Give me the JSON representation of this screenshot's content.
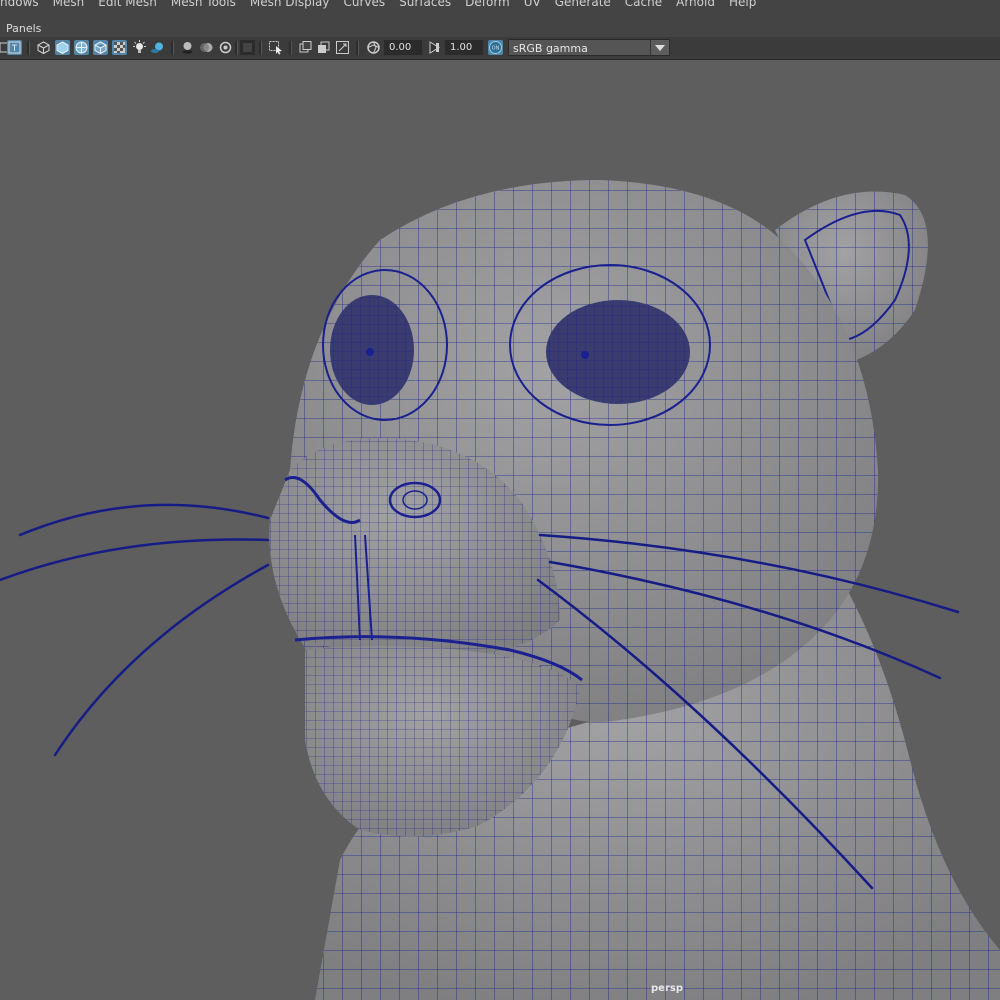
{
  "menubar": {
    "items": [
      "ndows",
      "Mesh",
      "Edit Mesh",
      "Mesh Tools",
      "Mesh Display",
      "Curves",
      "Surfaces",
      "Deform",
      "UV",
      "Generate",
      "Cache",
      "Arnold",
      "Help"
    ]
  },
  "panel": {
    "menu_label": "Panels"
  },
  "toolbar": {
    "exposure_value": "0.00",
    "gamma_value": "1.00",
    "color_management_label": "sRGB gamma",
    "icons": [
      "frame-icon",
      "film-gate-icon",
      "wireframe-icon",
      "smooth-shade-icon",
      "shade-wireframe-icon",
      "textured-icon",
      "xray-icon",
      "lights-icon",
      "shadows-icon",
      "ambient-occlusion-icon",
      "motion-blur-icon",
      "antialias-icon",
      "isolate-select-icon",
      "select-camera-icon",
      "two-panel-icon",
      "lock-camera-icon",
      "resolution-gate-icon",
      "exposure-icon",
      "gamma-icon",
      "color-management-icon"
    ]
  },
  "viewport": {
    "camera_name": "persp",
    "background_color": "#5e5e5e",
    "mesh_fill_color": "#8d8d8f",
    "wire_color": "#161c86"
  }
}
